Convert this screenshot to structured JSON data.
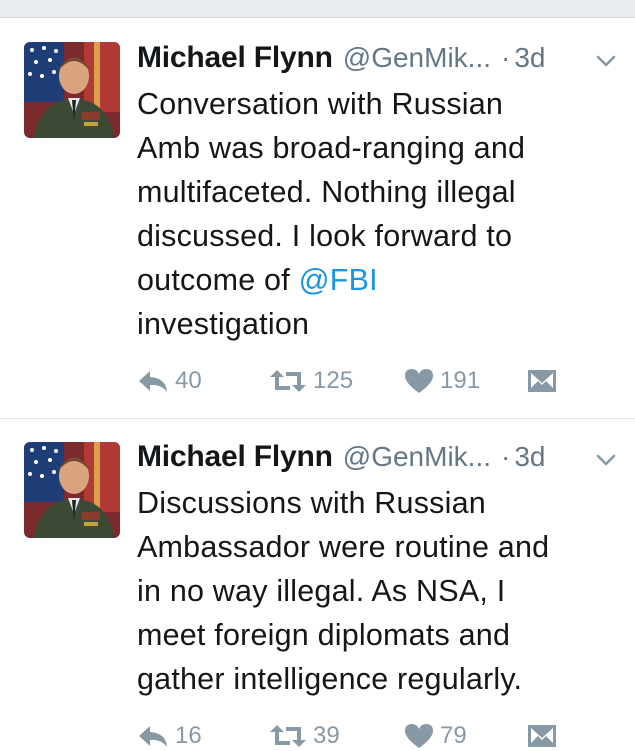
{
  "tweets": [
    {
      "author_name": "Michael Flynn",
      "handle": "@GenMik...",
      "separator": "·",
      "time": "3d",
      "text_lines": [
        "Conversation with Russian",
        "Amb was broad-ranging and",
        "multifaceted. Nothing illegal",
        "discussed. I look forward to",
        "outcome of ",
        "investigation"
      ],
      "mention": "@FBI",
      "reply_count": "40",
      "retweet_count": "125",
      "like_count": "191"
    },
    {
      "author_name": "Michael Flynn",
      "handle": "@GenMik...",
      "separator": "·",
      "time": "3d",
      "text_lines": [
        "Discussions with Russian",
        "Ambassador were routine and",
        "in no way illegal. As NSA, I",
        "meet foreign diplomats and",
        "gather intelligence regularly."
      ],
      "reply_count": "16",
      "retweet_count": "39",
      "like_count": "79"
    }
  ],
  "colors": {
    "text": "#14171a",
    "secondary": "#657786",
    "action_icon": "#8899a6",
    "link": "#1b95e0",
    "divider": "#e1e8ed"
  },
  "icons": [
    "reply-icon",
    "retweet-icon",
    "like-icon",
    "direct-message-icon",
    "chevron-down-icon"
  ]
}
